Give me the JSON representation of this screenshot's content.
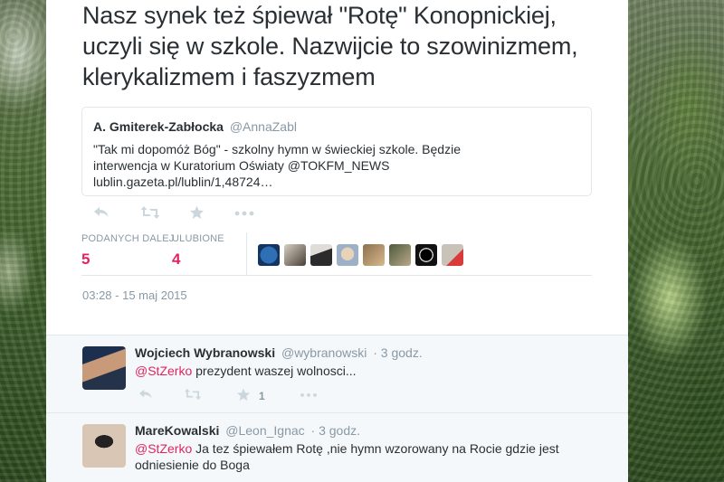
{
  "tweet": {
    "text": "Nasz synek też śpiewał \"Rotę\" Konopnickiej, uczyli się w szkole. Nazwijcie to szowinizmem, klerykalizmem i faszyzmem",
    "quote": {
      "name": "A. Gmiterek-Zabłocka",
      "handle": "@AnnaZabl",
      "text": "\"Tak mi dopomóż Bóg\" - szkolny hymn w świeckiej szkole. Będzie interwencja w Kuratorium Oświaty @TOKFM_NEWS lublin.gazeta.pl/lublin/1,48724…"
    },
    "actions": {
      "reply_icon": "reply-icon",
      "retweet_icon": "retweet-icon",
      "favorite_icon": "star-icon",
      "more_icon": "more-icon"
    },
    "stats": {
      "retweets_label": "PODANYCH DALEJ",
      "retweets_value": "5",
      "favorites_label": "ULUBIONE",
      "favorites_value": "4"
    },
    "date": "03:28 - 15 maj 2015"
  },
  "replies": [
    {
      "name": "Wojciech Wybranowski",
      "handle": "@wybranowski",
      "time": "· 3 godz.",
      "mention": "@StZerko",
      "text": " prezydent waszej wolnosci...",
      "favorite_count": "1"
    },
    {
      "name": "MareKowalski",
      "handle": "@Leon_Ignac",
      "time": "· 3 godz.",
      "mention": "@StZerko",
      "text": " Ja tez śpiewałem Rotę ,nie hymn wzorowany na Rocie gdzie jest odniesienie do Boga"
    }
  ],
  "colors": {
    "accent": "#e0245e",
    "muted": "#8899a6",
    "text": "#292f33"
  }
}
